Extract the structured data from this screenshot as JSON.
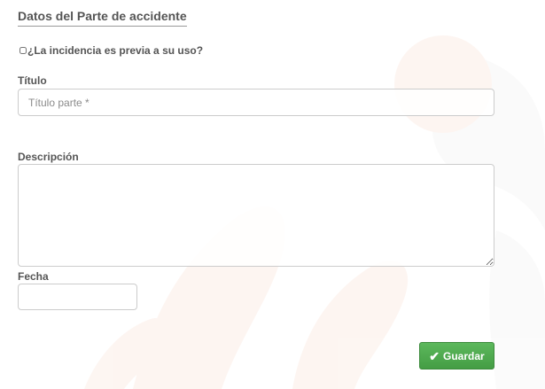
{
  "section": {
    "title": "Datos del Parte de accidente"
  },
  "incidencia": {
    "label": "¿La incidencia es previa a su uso?",
    "checked": false
  },
  "titulo": {
    "label": "Título",
    "placeholder": "Título parte *",
    "value": ""
  },
  "descripcion": {
    "label": "Descripción",
    "value": ""
  },
  "fecha": {
    "label": "Fecha",
    "value": ""
  },
  "actions": {
    "save_label": "Guardar",
    "save_icon": "check-icon",
    "save_color": "#5cb85c"
  }
}
